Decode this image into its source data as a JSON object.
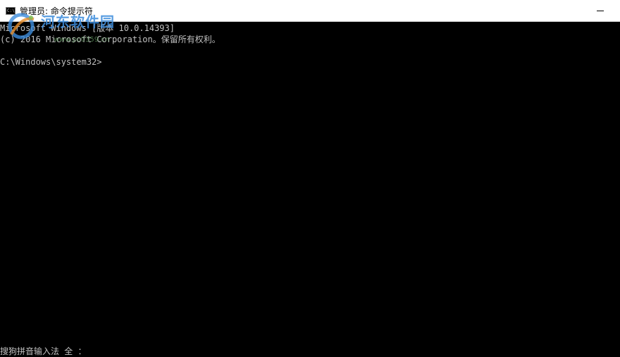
{
  "window": {
    "title": "管理员: 命令提示符",
    "icon": "cmd-icon",
    "icon_label": "C:\\"
  },
  "watermark": {
    "text": "河东软件园",
    "url": "www.pc0359.cn"
  },
  "console": {
    "lines": [
      "Microsoft Windows [版本 10.0.14393]",
      "(c) 2016 Microsoft Corporation。保留所有权利。",
      "",
      "C:\\Windows\\system32>"
    ]
  },
  "ime": {
    "status": "搜狗拼音输入法 全 ："
  },
  "colors": {
    "console_bg": "#000000",
    "console_fg": "#c0c0c0",
    "titlebar_bg": "#ffffff"
  }
}
